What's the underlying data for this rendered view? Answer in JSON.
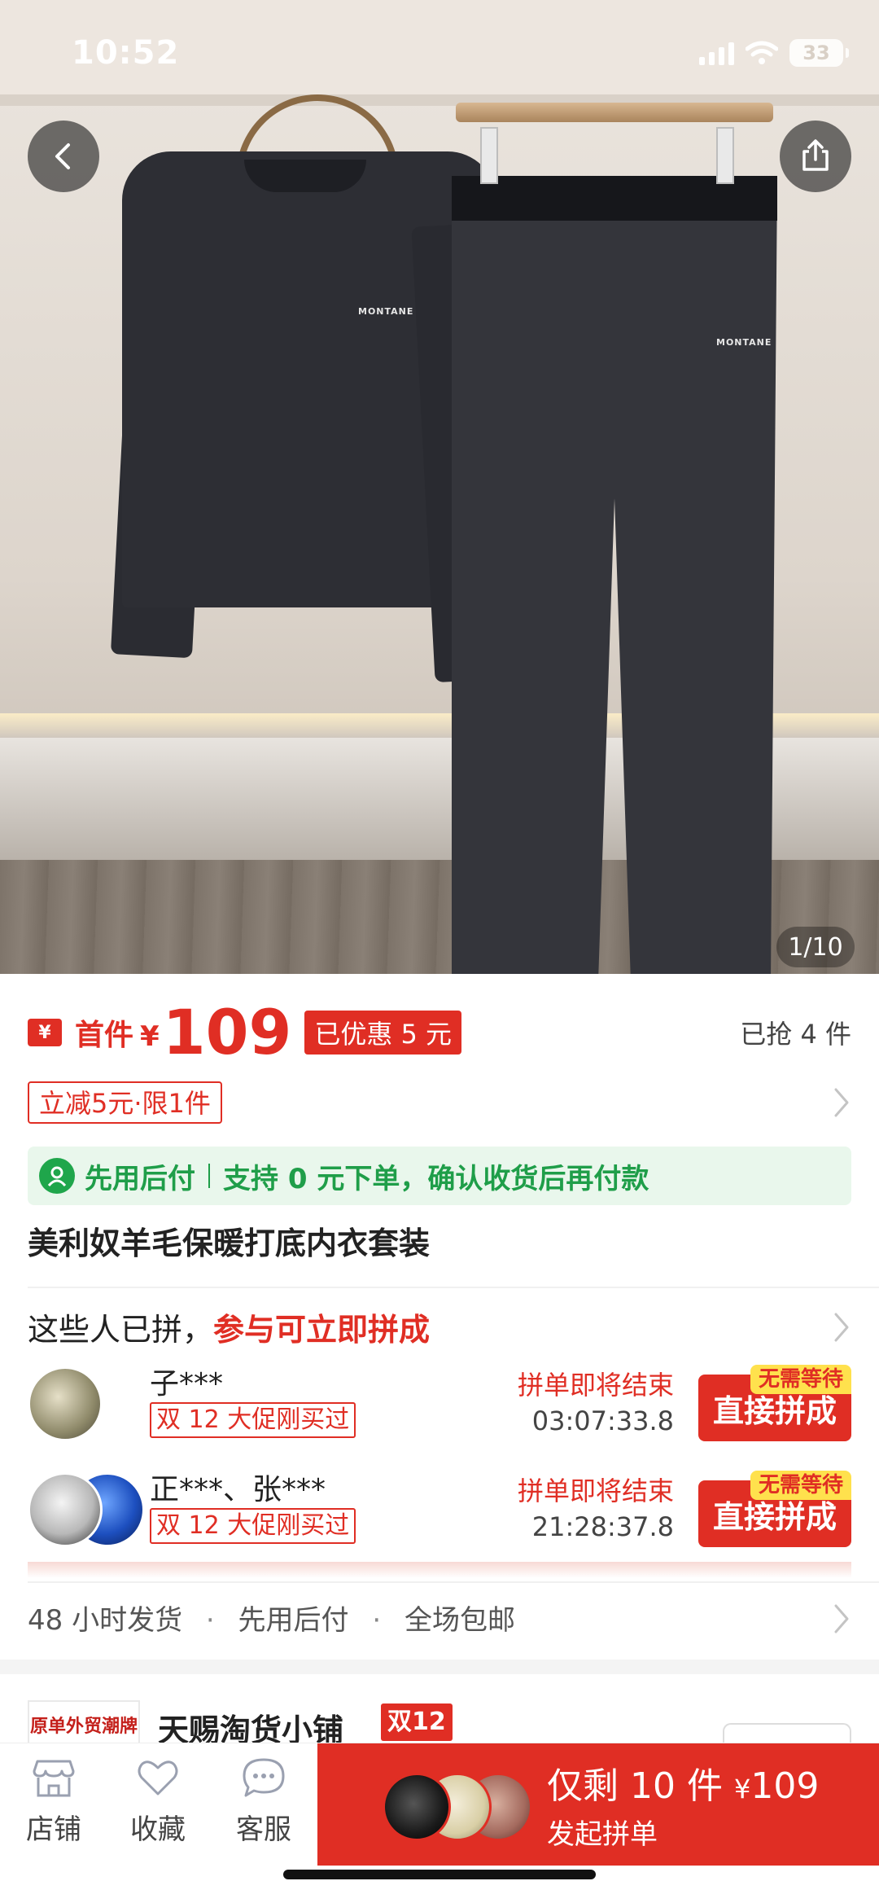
{
  "status": {
    "time": "10:52",
    "battery": "33"
  },
  "gallery": {
    "counter": "1/10",
    "logo_text": "MONTANE"
  },
  "price": {
    "coupon_icon": "¥",
    "label": "首件",
    "currency": "¥",
    "amount": "109",
    "discount": "已优惠 5 元",
    "sold": "已抢 4 件"
  },
  "limit": {
    "tag": "立减5元·限1件"
  },
  "paylater": {
    "title": "先用后付",
    "desc": "支持 0 元下单，确认收货后再付款"
  },
  "product": {
    "title": "美利奴羊毛保暖打底内衣套装"
  },
  "group": {
    "head_prefix": "这些人已拼，",
    "head_highlight": "参与可立即拼成",
    "rows": [
      {
        "name": "子***",
        "tag": "双 12 大促刚买过",
        "status": "拼单即将结束",
        "timer": "03:07:33.8",
        "button": "直接拼成",
        "button_tag": "无需等待"
      },
      {
        "name": "正***、张***",
        "tag": "双 12 大促刚买过",
        "status": "拼单即将结束",
        "timer": "21:28:37.8",
        "button": "直接拼成",
        "button_tag": "无需等待"
      }
    ]
  },
  "shipping": {
    "items": [
      "48 小时发货",
      "先用后付",
      "全场包邮"
    ]
  },
  "shop": {
    "logo": "原单外贸潮牌",
    "name": "天赐淘货小铺",
    "badge": "双12"
  },
  "bottom_nav": {
    "store": "店铺",
    "favorite": "收藏",
    "service": "客服",
    "buy_top": "仅剩 10 件",
    "buy_currency": "¥",
    "buy_price": "109",
    "buy_sub": "发起拼单"
  },
  "colors": {
    "accent": "#e02e24",
    "paylater_green": "#1f9e49",
    "paylater_bg": "#e9f7ec",
    "coupon_yellow": "#ffe14d"
  },
  "icons": [
    "back-arrow-icon",
    "share-icon",
    "coupon-icon",
    "paylater-icon",
    "chevron-right-icon",
    "store-icon",
    "heart-icon",
    "chat-icon"
  ]
}
